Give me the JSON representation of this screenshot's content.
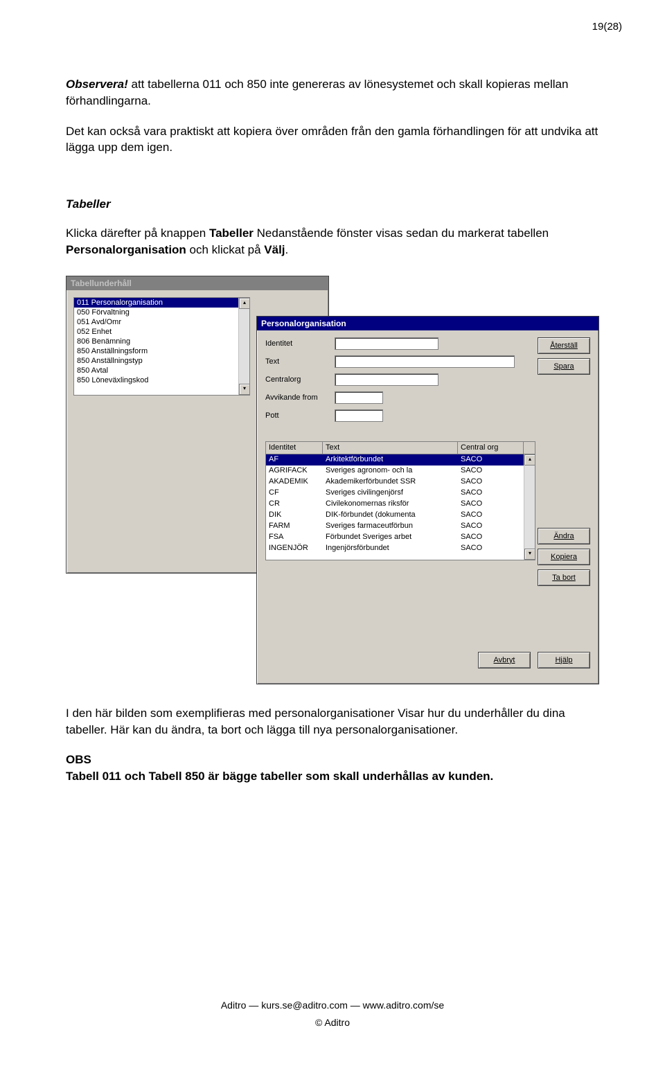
{
  "page_number": "19(28)",
  "intro": {
    "p1_prefix": "Observera!",
    "p1_rest": " att tabellerna 011 och 850 inte genereras av lönesystemet och skall kopieras mellan förhandlingarna.",
    "p2": "Det kan också vara praktiskt att kopiera över områden från den gamla förhandlingen för att undvika att lägga upp dem igen."
  },
  "section_heading": "Tabeller",
  "section_para": {
    "t1": "Klicka därefter på knappen ",
    "b1": "Tabeller",
    "t2": " Nedanstående fönster visas sedan du markerat tabellen ",
    "b2": "Personalorganisation",
    "t3": " och klickat på ",
    "b3": "Välj",
    "t4": "."
  },
  "win_back": {
    "title": "Tabellunderhåll",
    "items": [
      "011 Personalorganisation",
      "050 Förvaltning",
      "051 Avd/Omr",
      "052 Enhet",
      "806 Benämning",
      "850 Anställningsform",
      "850 Anställningstyp",
      "850 Avtal",
      "850 Löneväxlingskod"
    ]
  },
  "win_front": {
    "title": "Personalorganisation",
    "labels": {
      "identitet": "Identitet",
      "text": "Text",
      "centralorg": "Centralorg",
      "avvik": "Avvikande from",
      "pott": "Pott"
    },
    "headers": {
      "c1": "Identitet",
      "c2": "Text",
      "c3": "Central org"
    },
    "rows": [
      {
        "c1": "AF",
        "c2": "Arkitektförbundet",
        "c3": "SACO",
        "sel": true
      },
      {
        "c1": "AGRIFACK",
        "c2": "Sveriges agronom- och la",
        "c3": "SACO"
      },
      {
        "c1": "AKADEMIK",
        "c2": "Akademikerförbundet SSR",
        "c3": "SACO"
      },
      {
        "c1": "CF",
        "c2": "Sveriges civilingenjörsf",
        "c3": "SACO"
      },
      {
        "c1": "CR",
        "c2": "Civilekonomernas riksför",
        "c3": "SACO"
      },
      {
        "c1": "DIK",
        "c2": "DIK-förbundet (dokumenta",
        "c3": "SACO"
      },
      {
        "c1": "FARM",
        "c2": "Sveriges farmaceutförbun",
        "c3": "SACO"
      },
      {
        "c1": "FSA",
        "c2": "Förbundet Sveriges arbet",
        "c3": "SACO"
      },
      {
        "c1": "INGENJÖR",
        "c2": "Ingenjörsförbundet",
        "c3": "SACO"
      }
    ],
    "buttons": {
      "aterstall": "Återställ",
      "spara": "Spara",
      "andra": "Ändra",
      "kopiera": "Kopiera",
      "tabort": "Ta bort",
      "avbryt": "Avbryt",
      "hjalp": "Hjälp"
    }
  },
  "after": {
    "p1": "I den här bilden som exemplifieras med personalorganisationer Visar hur du underhåller du dina tabeller. Här kan du ändra, ta bort och lägga till nya personalorganisationer.",
    "obs": "OBS",
    "p2": "Tabell 011 och Tabell 850 är bägge tabeller som skall underhållas av kunden."
  },
  "footer": {
    "line1": "Aditro  —  kurs.se@aditro.com  —  www.aditro.com/se",
    "line2": "© Aditro"
  }
}
